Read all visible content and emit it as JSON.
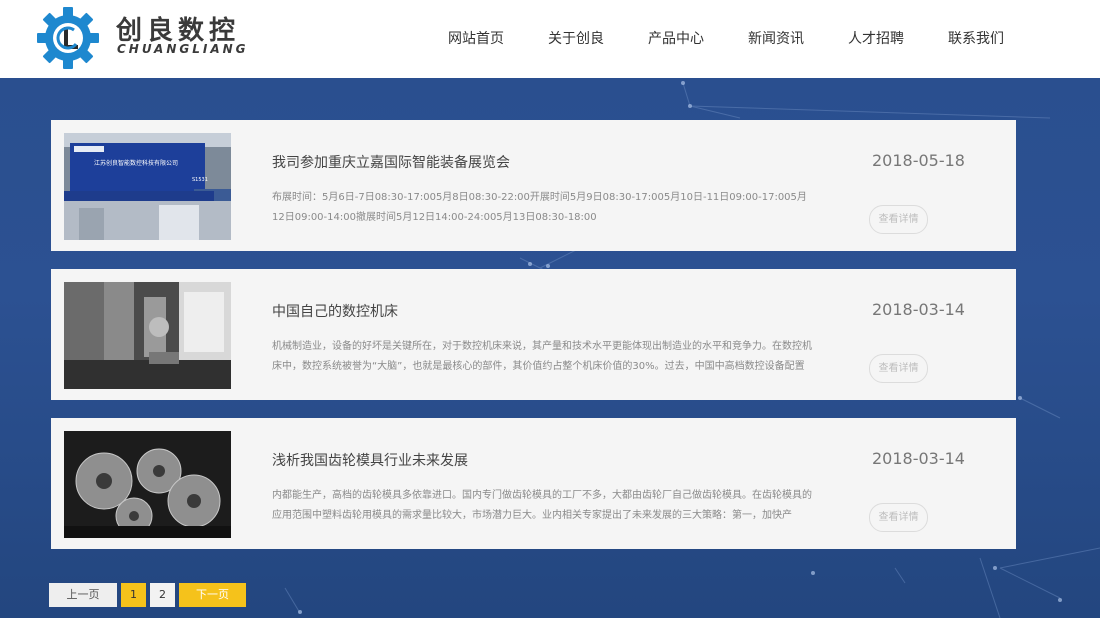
{
  "brand": {
    "name_cn": "创良数控",
    "name_en": "CHUANGLIANG"
  },
  "nav": [
    {
      "label": "网站首页"
    },
    {
      "label": "关于创良"
    },
    {
      "label": "产品中心"
    },
    {
      "label": "新闻资讯"
    },
    {
      "label": "人才招聘"
    },
    {
      "label": "联系我们"
    }
  ],
  "news": [
    {
      "title": "我司参加重庆立嘉国际智能装备展览会",
      "date": "2018-05-18",
      "desc": "布展时间：5月6日-7日08:30-17:005月8日08:30-22:00开展时间5月9日08:30-17:005月10日-11日09:00-17:005月12日09:00-14:00撤展时间5月12日14:00-24:005月13日08:30-18:00",
      "more": "查看详情",
      "thumb_text_1": "江苏创良智能数控科技有限公司",
      "thumb_text_2": "S1531"
    },
    {
      "title": "中国自己的数控机床",
      "date": "2018-03-14",
      "desc": "机械制造业，设备的好坏是关键所在，对于数控机床来说，其产量和技术水平更能体现出制造业的水平和竞争力。在数控机床中，数控系统被誉为“大脑”，也就是最核心的部件，其价值约占整个机床价值的30%。过去，中国中高档数控设备配置",
      "more": "查看详情"
    },
    {
      "title": "浅析我国齿轮模具行业未来发展",
      "date": "2018-03-14",
      "desc": "内都能生产，高档的齿轮模具多依靠进口。国内专门做齿轮模具的工厂不多，大都由齿轮厂自己做齿轮模具。在齿轮模具的应用范围中塑料齿轮用模具的需求量比较大，市场潜力巨大。业内相关专家提出了未来发展的三大策略：第一，加快产",
      "more": "查看详情"
    }
  ],
  "pagination": {
    "prev": "上一页",
    "pages": [
      "1",
      "2"
    ],
    "current": "1",
    "next": "下一页"
  },
  "colors": {
    "header_bg": "#ffffff",
    "bg_blue": "#2a4d8c",
    "card_bg": "#f5f5f5",
    "accent_yellow": "#f5c21b",
    "logo_blue": "#1e8ad0"
  }
}
